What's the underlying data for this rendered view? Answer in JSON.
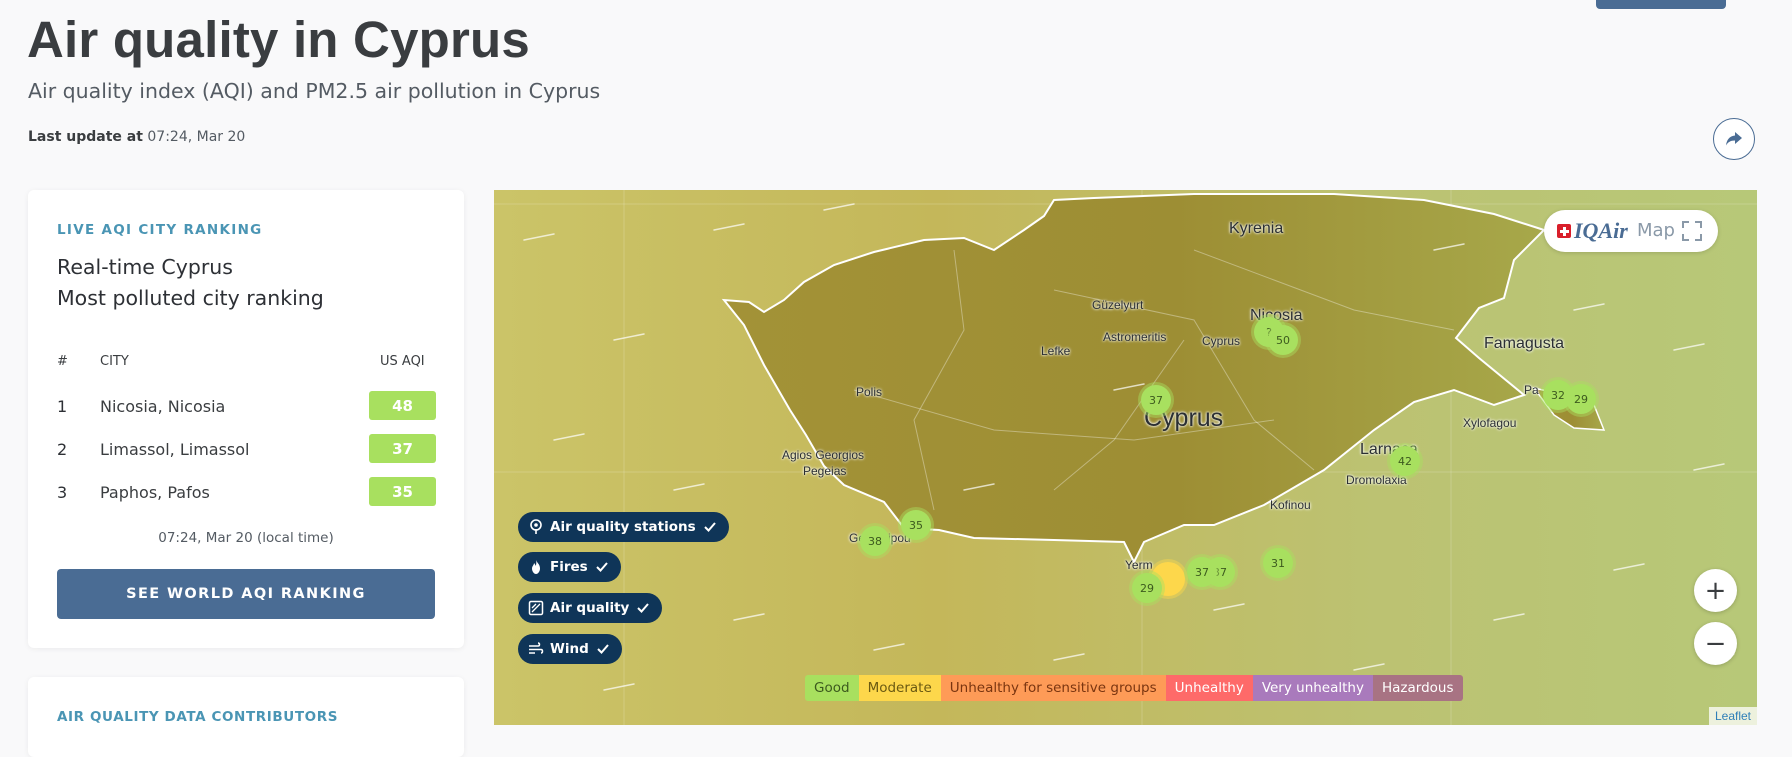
{
  "header": {
    "title": "Air quality in Cyprus",
    "subtitle": "Air quality index (AQI) and PM2.5 air pollution in Cyprus",
    "last_update_label": "Last update at",
    "last_update_value": "07:24, Mar 20"
  },
  "ranking": {
    "eyebrow": "LIVE AQI CITY RANKING",
    "heading_line1": "Real-time Cyprus",
    "heading_line2": "Most polluted city ranking",
    "columns": {
      "rank": "#",
      "city": "CITY",
      "aqi": "US AQI"
    },
    "rows": [
      {
        "rank": "1",
        "city": "Nicosia, Nicosia",
        "aqi": "48"
      },
      {
        "rank": "2",
        "city": "Limassol, Limassol",
        "aqi": "37"
      },
      {
        "rank": "3",
        "city": "Paphos, Pafos",
        "aqi": "35"
      }
    ],
    "time_note": "07:24, Mar 20 (local time)",
    "button_label": "SEE WORLD AQI RANKING"
  },
  "contributors": {
    "title": "AIR QUALITY DATA CONTRIBUTORS"
  },
  "map": {
    "brand": {
      "logo": "IQAir",
      "label": "Map"
    },
    "places": {
      "kyrenia": "Kyrenia",
      "nicosia": "Nicosia",
      "guzelyurt": "Güzelyurt",
      "astromeritis": "Astromeritis",
      "cyprus_town": "Cyprus",
      "lefke": "Lefke",
      "famagusta": "Famagusta",
      "polis": "Polis",
      "agios_georgios": "Agios Georgios",
      "pegeias": "Pegeias",
      "cyprus_country": "Cyprus",
      "larnaca": "Larnaca",
      "dromolaxia": "Dromolaxia",
      "xylofagou": "Xylofagou",
      "paralimni": "Pa",
      "kofinou": "Kofinou",
      "yermasogeia": "Yerm",
      "geroskipou": "Ger",
      "geroskipou_tail": "kipou"
    },
    "markers": {
      "nicosia_a": "?",
      "nicosia_b": "50",
      "central": "37",
      "famagusta_a": "32",
      "famagusta_b": "29",
      "larnaca": "42",
      "paphos_a": "35",
      "paphos_b": "38",
      "limassol_a": "29",
      "limassol_b": "37",
      "limassol_c": "37",
      "coast": "31"
    },
    "layers": {
      "stations": "Air quality stations",
      "fires": "Fires",
      "air_quality": "Air quality",
      "wind": "Wind"
    },
    "zoom_in": "+",
    "zoom_out": "−",
    "legend": [
      {
        "label": "Good",
        "bg": "#a8e05f",
        "fg": "#3c5a1e"
      },
      {
        "label": "Moderate",
        "bg": "#fdd74b",
        "fg": "#6b5a12"
      },
      {
        "label": "Unhealthy for sensitive groups",
        "bg": "#fe9b57",
        "fg": "#7a3510"
      },
      {
        "label": "Unhealthy",
        "bg": "#fe6a69",
        "fg": "#ffffff"
      },
      {
        "label": "Very unhealthy",
        "bg": "#a97abc",
        "fg": "#ffffff"
      },
      {
        "label": "Hazardous",
        "bg": "#a87383",
        "fg": "#ffffff"
      }
    ],
    "attribution": "Leaflet"
  },
  "colors": {
    "accent": "#4a6c94",
    "good": "#a8e05f",
    "moderate": "#fdd74b",
    "eyebrow": "#4a95b4",
    "layer_pill": "#0f3558"
  }
}
